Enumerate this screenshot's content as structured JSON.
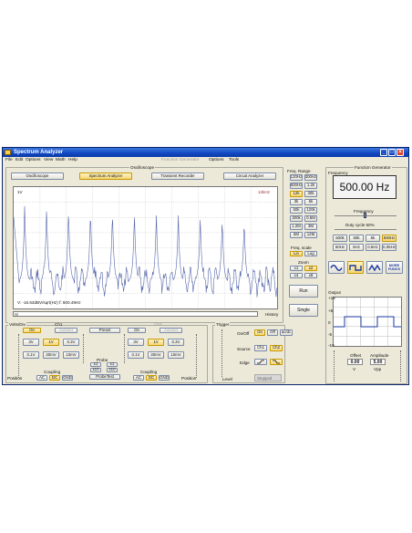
{
  "window": {
    "title": "Spectrum Analyzer"
  },
  "menu": {
    "file": "File",
    "edit": "Edit",
    "options": "Options",
    "view": "View",
    "math": "Math",
    "help": "Help",
    "function_generator": "Function Generator",
    "options2": "Options",
    "tools": "Tools"
  },
  "oscilloscope": {
    "section_label": "Oscilloscope",
    "tabs": [
      "Oscilloscope",
      "Spectrum Analyzer",
      "Transient Recorder",
      "Circuit Analyzer"
    ],
    "scale_left": "1V",
    "scale_right": "12kHz",
    "readout": "V: -16.63dBV/sqrt(Hz)    f: 500.49Hz",
    "history_label": "History",
    "trace_peaks_hz": [
      500,
      1500,
      2500,
      3500,
      4500,
      5500,
      6500,
      7500,
      8500,
      9500,
      10500
    ],
    "trace_color": "#5566aa"
  },
  "freq_range": {
    "label": "Freq. Range",
    "options": [
      "120Hz",
      "300Hz",
      "600Hz",
      "1.2k",
      "12k",
      "30k",
      "3k",
      "6k",
      "60k",
      "120k",
      "300k",
      "0.6M",
      "1.2M",
      "3M",
      "6M",
      "12M"
    ],
    "selected": "12k"
  },
  "freq_scale": {
    "label": "Freq. scale",
    "lin": "Lin",
    "log": "Log",
    "selected": "Lin"
  },
  "zoom": {
    "label": "Zoom",
    "options": [
      "x1",
      "x2",
      "x4",
      "x8"
    ],
    "selected": "x1"
  },
  "run_label": "Run",
  "single_label": "Single",
  "volts_div": {
    "label": "Volts/Div",
    "ch1": "Ch1",
    "ch2": "Ch2",
    "ch1_on": "On",
    "ch1_autoset": "Autoset",
    "ch2_on": "On",
    "ch2_autoset": "Autoset",
    "preset": "Preset",
    "ch1_volts": [
      "3V",
      "1V",
      "0.3V",
      "0.1V",
      "30mV",
      "10mV"
    ],
    "ch2_volts": [
      "3V",
      "1V",
      "0.3V",
      "0.1V",
      "30mV",
      "10mV"
    ],
    "selected": "1V",
    "probe_label": "Probe",
    "probe_options": [
      "x1",
      "x1",
      "x10",
      "x10"
    ],
    "probe_test": "ProbeTest",
    "coupling_label": "Coupling",
    "coupling_options": [
      "AC",
      "DC",
      "GND"
    ],
    "coupling_selected": "DC",
    "position_label": "Position"
  },
  "trigger": {
    "label": "Trigger",
    "onoff_label": "On/Off",
    "on": "On",
    "off": "Off",
    "auto": "ac/dc",
    "source_label": "Source",
    "ch1": "Ch1",
    "ch2": "Ch2",
    "edge_label": "Edge",
    "level_label": "Level",
    "status": "Stopped"
  },
  "function_generator": {
    "label": "Function Generator",
    "frequency_label": "Frequency",
    "display": "500.00 Hz",
    "frequency_slider_label": "Frequency",
    "duty_cycle": "Duty cycle 50%",
    "freq_buttons": [
      "500k",
      "50k",
      "5k",
      "500Hz",
      "50Hz",
      "5Hz",
      "0.5Hz",
      "0.05Hz"
    ],
    "selected_freq": "500Hz",
    "more_funcs": "MORE FUNCS",
    "output_label": "Output",
    "output_y": [
      "+15",
      "+5",
      "0",
      "-5",
      "-10"
    ],
    "offset_label": "Offset",
    "amplitude_label": "Amplitude",
    "offset_value": "0.00",
    "amplitude_value": "5.00",
    "offset_unit": "V",
    "amplitude_unit": "Vpp"
  }
}
